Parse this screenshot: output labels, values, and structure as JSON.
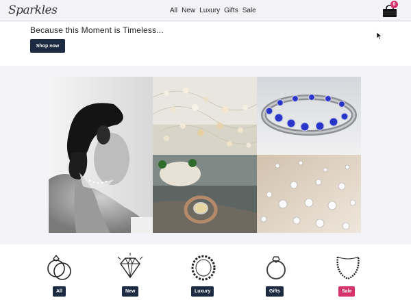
{
  "header": {
    "logo_text": "Sparkles",
    "nav": [
      "All",
      "New",
      "Luxury",
      "Gifts",
      "Sale"
    ],
    "cart_count": "0"
  },
  "hero": {
    "title": "Because this Moment is Timeless...",
    "button_label": "Shop now"
  },
  "categories": [
    {
      "label": "All",
      "icon": "rings-icon",
      "color": "#1c2b42"
    },
    {
      "label": "New",
      "icon": "diamond-icon",
      "color": "#1c2b42"
    },
    {
      "label": "Luxury",
      "icon": "bracelet-icon",
      "color": "#1c2b42"
    },
    {
      "label": "Gifts",
      "icon": "ring-icon",
      "color": "#1c2b42"
    },
    {
      "label": "Sale",
      "icon": "necklace-icon",
      "color": "#d6336c"
    }
  ],
  "colors": {
    "accent": "#1c2b42",
    "sale": "#d6336c"
  }
}
